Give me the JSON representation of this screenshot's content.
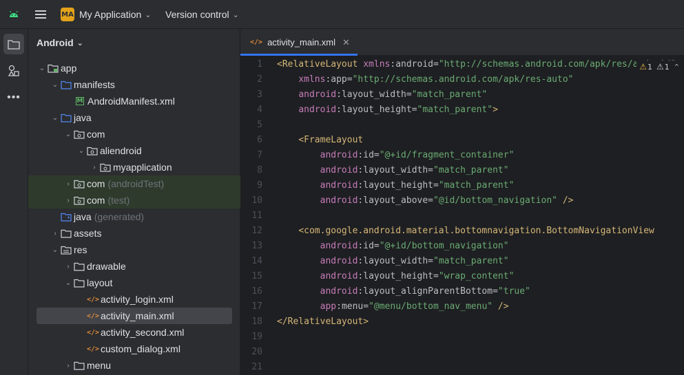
{
  "titlebar": {
    "project_badge": "MA",
    "project_name": "My Application",
    "vcs_label": "Version control"
  },
  "project_panel": {
    "view_label": "Android",
    "tree": [
      {
        "label": "app",
        "sub": "",
        "icon": "module-folder-icon",
        "expanded": true
      },
      {
        "label": "manifests",
        "sub": "",
        "icon": "folder-icon",
        "expanded": true
      },
      {
        "label": "AndroidManifest.xml",
        "sub": "",
        "icon": "manifest-file-icon"
      },
      {
        "label": "java",
        "sub": "",
        "icon": "folder-icon",
        "expanded": true
      },
      {
        "label": "com",
        "sub": "",
        "icon": "package-icon",
        "expanded": true
      },
      {
        "label": "aliendroid",
        "sub": "",
        "icon": "package-icon",
        "expanded": true
      },
      {
        "label": "myapplication",
        "sub": "",
        "icon": "package-icon",
        "expanded": false
      },
      {
        "label": "com",
        "sub": "(androidTest)",
        "icon": "package-icon",
        "expanded": false
      },
      {
        "label": "com",
        "sub": "(test)",
        "icon": "package-icon",
        "expanded": false
      },
      {
        "label": "java",
        "sub": "(generated)",
        "icon": "generated-folder-icon"
      },
      {
        "label": "assets",
        "sub": "",
        "icon": "folder-icon",
        "expanded": false
      },
      {
        "label": "res",
        "sub": "",
        "icon": "resource-folder-icon",
        "expanded": true
      },
      {
        "label": "drawable",
        "sub": "",
        "icon": "folder-icon",
        "expanded": false
      },
      {
        "label": "layout",
        "sub": "",
        "icon": "folder-icon",
        "expanded": true
      },
      {
        "label": "activity_login.xml",
        "sub": "",
        "icon": "xml-file-icon"
      },
      {
        "label": "activity_main.xml",
        "sub": "",
        "icon": "xml-file-icon"
      },
      {
        "label": "activity_second.xml",
        "sub": "",
        "icon": "xml-file-icon"
      },
      {
        "label": "custom_dialog.xml",
        "sub": "",
        "icon": "xml-file-icon"
      },
      {
        "label": "menu",
        "sub": "",
        "icon": "folder-icon",
        "expanded": false
      }
    ]
  },
  "editor": {
    "tab_label": "activity_main.xml",
    "warnings": {
      "yellow_count": "1",
      "grey_count": "1"
    },
    "line_numbers": [
      "1",
      "2",
      "3",
      "4",
      "5",
      "6",
      "7",
      "8",
      "9",
      "10",
      "11",
      "12",
      "13",
      "14",
      "15",
      "16",
      "17",
      "18",
      "19",
      "20",
      "21"
    ],
    "code_lines": [
      "<RelativeLayout xmlns:android=\"http://schemas.android.com/apk/res/android\"",
      "    xmlns:app=\"http://schemas.android.com/apk/res-auto\"",
      "    android:layout_width=\"match_parent\"",
      "    android:layout_height=\"match_parent\">",
      "",
      "    <FrameLayout",
      "        android:id=\"@+id/fragment_container\"",
      "        android:layout_width=\"match_parent\"",
      "        android:layout_height=\"match_parent\"",
      "        android:layout_above=\"@id/bottom_navigation\" />",
      "",
      "    <com.google.android.material.bottomnavigation.BottomNavigationView",
      "        android:id=\"@+id/bottom_navigation\"",
      "        android:layout_width=\"match_parent\"",
      "        android:layout_height=\"wrap_content\"",
      "        android:layout_alignParentBottom=\"true\"",
      "        app:menu=\"@menu/bottom_nav_menu\" />",
      "</RelativeLayout>",
      "",
      "",
      ""
    ]
  }
}
